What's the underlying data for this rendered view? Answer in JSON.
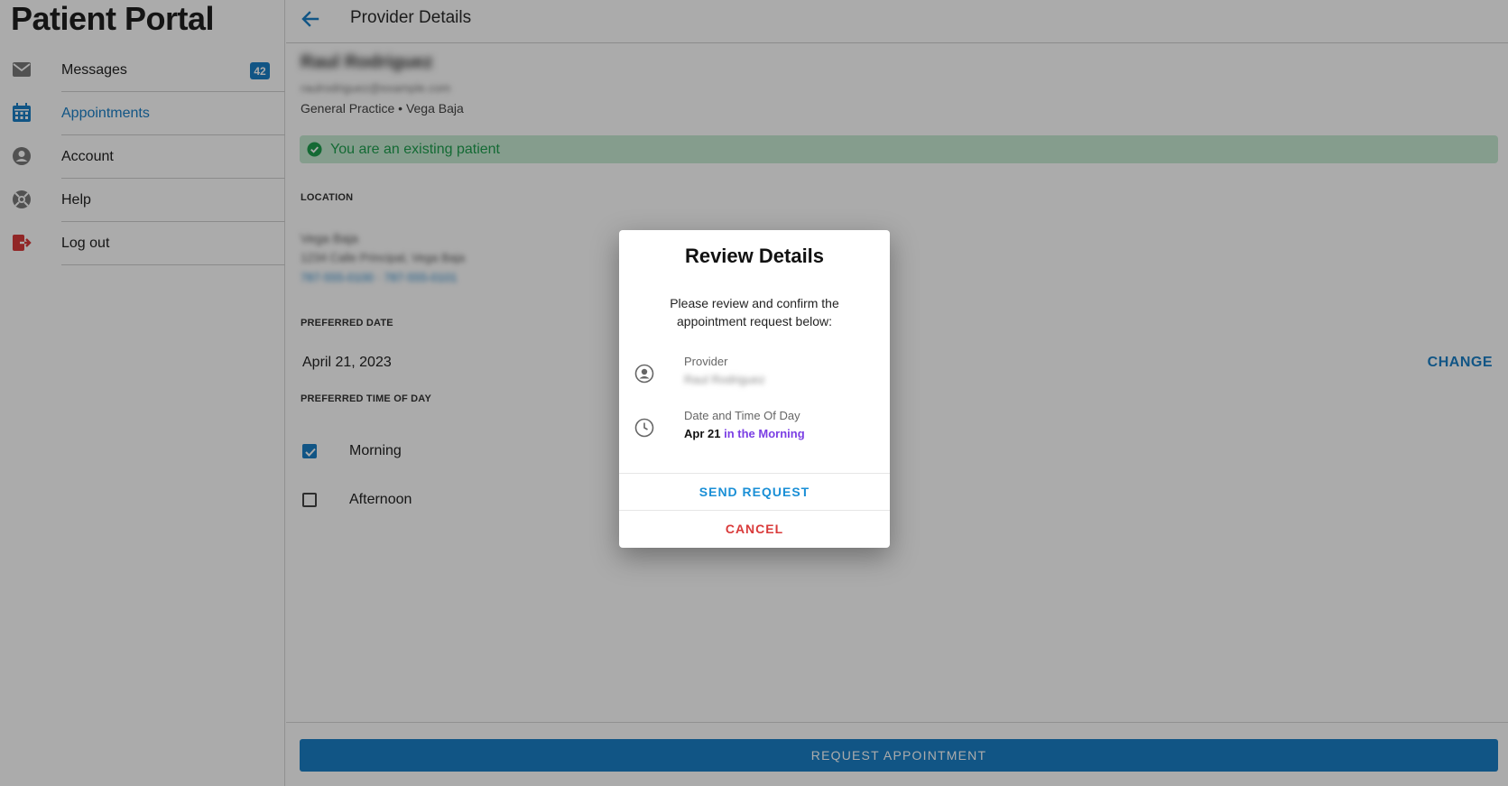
{
  "app": {
    "title": "Patient Portal"
  },
  "sidebar": {
    "items": [
      {
        "label": "Messages",
        "badge": "42",
        "icon": "mail-icon"
      },
      {
        "label": "Appointments",
        "icon": "calendar-icon",
        "active": true
      },
      {
        "label": "Account",
        "icon": "account-circle-icon"
      },
      {
        "label": "Help",
        "icon": "lifebuoy-icon"
      },
      {
        "label": "Log out",
        "icon": "logout-icon"
      }
    ]
  },
  "header": {
    "title": "Provider Details",
    "back_icon": "arrow-back-icon"
  },
  "provider": {
    "name": "Raul Rodriguez",
    "email": "raulrodriguez@example.com",
    "meta": "General Practice • Vega Baja"
  },
  "banner": {
    "text": "You are an existing patient",
    "icon": "check-circle-icon"
  },
  "location": {
    "label": "LOCATION",
    "name": "Vega Baja",
    "address": "1234 Calle Principal, Vega Baja",
    "links": "787-555-0100 · 787-555-0101"
  },
  "preferred_date": {
    "label": "PREFERRED DATE",
    "value": "April 21, 2023",
    "change_label": "CHANGE"
  },
  "preferred_time": {
    "label": "PREFERRED TIME OF DAY",
    "options": [
      {
        "label": "Morning",
        "checked": true
      },
      {
        "label": "Afternoon",
        "checked": false
      }
    ]
  },
  "footer": {
    "request_label": "REQUEST APPOINTMENT"
  },
  "modal": {
    "title": "Review Details",
    "description": "Please review and confirm the appointment request below:",
    "provider_label": "Provider",
    "provider_value": "Raul Rodriguez",
    "datetime_label": "Date and Time Of Day",
    "date_value": "Apr 21",
    "time_value": "in the Morning",
    "send_label": "SEND REQUEST",
    "cancel_label": "CANCEL"
  },
  "colors": {
    "accent": "#1a7fc6",
    "success_bg": "#c6ebd3",
    "success_text": "#1e9e4e",
    "danger": "#d93a3a",
    "purple": "#7b3fe4"
  }
}
